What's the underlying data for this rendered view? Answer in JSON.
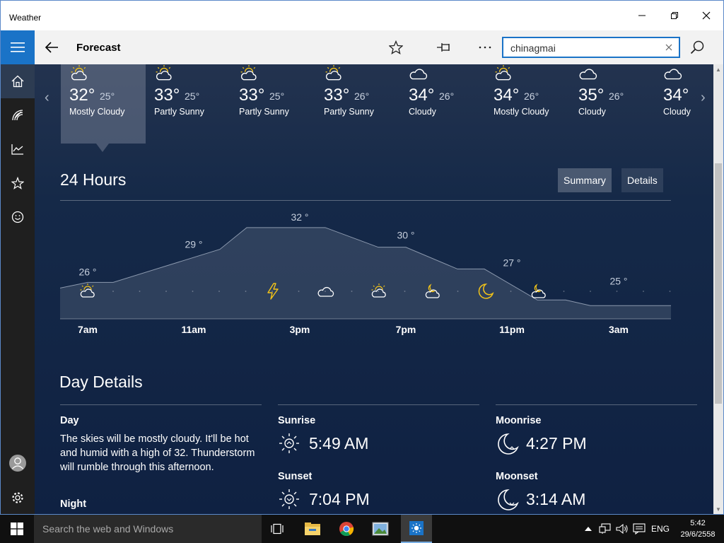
{
  "window": {
    "title": "Weather"
  },
  "appbar": {
    "page_title": "Forecast",
    "search_value": "chinagmai"
  },
  "forecast_days": [
    {
      "high": "32°",
      "low": "25°",
      "condition": "Mostly Cloudy",
      "icon": "partly-sunny-icon"
    },
    {
      "high": "33°",
      "low": "25°",
      "condition": "Partly Sunny",
      "icon": "partly-sunny-icon"
    },
    {
      "high": "33°",
      "low": "25°",
      "condition": "Partly Sunny",
      "icon": "partly-sunny-icon"
    },
    {
      "high": "33°",
      "low": "26°",
      "condition": "Partly Sunny",
      "icon": "partly-sunny-icon"
    },
    {
      "high": "34°",
      "low": "26°",
      "condition": "Cloudy",
      "icon": "cloud-icon"
    },
    {
      "high": "34°",
      "low": "26°",
      "condition": "Mostly Cloudy",
      "icon": "partly-sunny-icon"
    },
    {
      "high": "35°",
      "low": "26°",
      "condition": "Cloudy",
      "icon": "cloud-icon"
    },
    {
      "high": "34°",
      "low": "",
      "condition": "Cloudy",
      "icon": "cloud-icon"
    }
  ],
  "hourly": {
    "title": "24 Hours",
    "summary_label": "Summary",
    "details_label": "Details",
    "time_labels": [
      "7am",
      "11am",
      "3pm",
      "7pm",
      "11pm",
      "3am"
    ],
    "temp_labels": [
      "26 °",
      "29 °",
      "32 °",
      "30 °",
      "27 °",
      "25 °"
    ],
    "icons": [
      "partly-sunny-icon",
      "thunder-icon",
      "cloud-icon",
      "partly-sunny-icon",
      "partly-cloudy-night-icon",
      "moon-icon",
      "partly-cloudy-night-icon"
    ]
  },
  "chart_data": {
    "type": "area",
    "title": "24 Hours",
    "x": [
      "7am",
      "11am",
      "3pm",
      "7pm",
      "11pm",
      "3am"
    ],
    "series": [
      {
        "values": [
          26,
          29,
          32,
          30,
          27,
          25
        ]
      }
    ],
    "xlabel": "",
    "ylabel": ""
  },
  "day_details": {
    "title": "Day Details",
    "day_label": "Day",
    "day_text": "The skies will be mostly cloudy. It'll be hot and humid with a high of 32. Thunderstorm will rumble through this afternoon.",
    "night_label": "Night",
    "sunrise_label": "Sunrise",
    "sunrise": "5:49 AM",
    "sunset_label": "Sunset",
    "sunset": "7:04 PM",
    "moonrise_label": "Moonrise",
    "moonrise": "4:27 PM",
    "moonset_label": "Moonset",
    "moonset": "3:14 AM"
  },
  "taskbar": {
    "search_placeholder": "Search the web and Windows",
    "language": "ENG",
    "time": "5:42",
    "date": "29/6/2558"
  },
  "colors": {
    "accent": "#1a73c7",
    "sun": "#f2c318",
    "panel": "#0f2142"
  }
}
